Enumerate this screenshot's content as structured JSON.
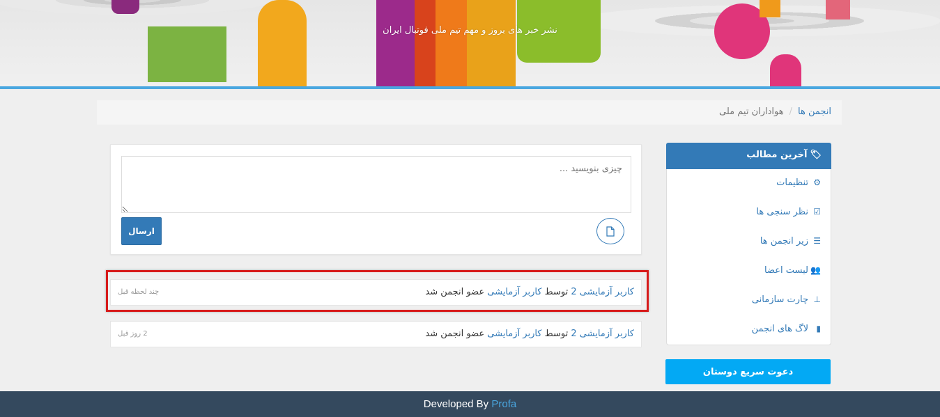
{
  "header": {
    "tagline": "نشر خبر های بروز و مهم تیم ملی فوتبال ایران"
  },
  "breadcrumb": {
    "root": "انجمن ها",
    "current": "هواداران تیم ملی"
  },
  "composer": {
    "placeholder": "چیزی بنویسید ...",
    "send_label": "ارسال",
    "attach_icon": "file-icon"
  },
  "activities": [
    {
      "user": "کاربر آزمایشی 2",
      "by_word": "توسط",
      "actor": "کاربر آزمایشی",
      "action": "عضو انجمن شد",
      "time": "چند لحظه قبل"
    },
    {
      "user": "کاربر آزمایشی 2",
      "by_word": "توسط",
      "actor": "کاربر آزمایشی",
      "action": "عضو انجمن شد",
      "time": "2 روز قبل"
    }
  ],
  "sidebar": {
    "title": "آخرین مطالب",
    "title_icon": "tags-icon",
    "items": [
      {
        "label": "تنظیمات",
        "icon": "cogs-icon"
      },
      {
        "label": "نظر سنجی ها",
        "icon": "check-square-icon"
      },
      {
        "label": "زیر انجمن ها",
        "icon": "list-icon"
      },
      {
        "label": "لیست اعضا",
        "icon": "users-icon"
      },
      {
        "label": "چارت سازمانی",
        "icon": "sitemap-icon"
      },
      {
        "label": "لاگ های انجمن",
        "icon": "file-icon"
      }
    ],
    "invite_label": "دعوت سریع دوستان"
  },
  "footer": {
    "prefix": "Developed By",
    "brand": "Profa"
  },
  "colors": {
    "primary": "#337ab7",
    "accent": "#03a9f4",
    "footer": "#34495e",
    "highlight": "#d71a1a"
  }
}
